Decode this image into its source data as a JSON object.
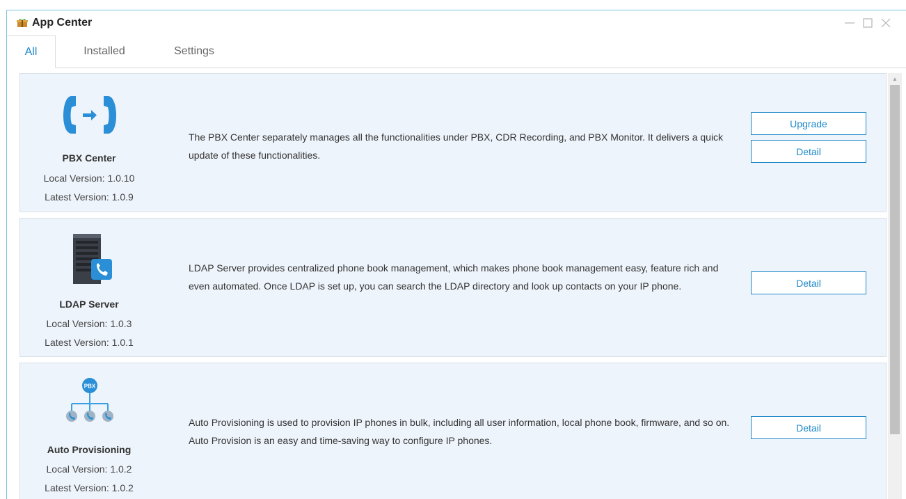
{
  "window": {
    "title": "App Center",
    "icon": "app-center-icon",
    "controls": [
      "minimize-icon",
      "maximize-icon",
      "close-icon"
    ]
  },
  "tabs": [
    {
      "label": "All",
      "active": true
    },
    {
      "label": "Installed",
      "active": false
    },
    {
      "label": "Settings",
      "active": false
    }
  ],
  "apps": [
    {
      "name": "PBX Center",
      "icon": "pbx-center-icon",
      "local_version": "Local Version: 1.0.10",
      "latest_version": "Latest Version: 1.0.9",
      "description": "The PBX Center separately manages all the functionalities under PBX, CDR Recording, and PBX Monitor. It delivers a quick update of these functionalities.",
      "buttons": [
        "Upgrade",
        "Detail"
      ]
    },
    {
      "name": "LDAP Server",
      "icon": "ldap-server-icon",
      "local_version": "Local Version: 1.0.3",
      "latest_version": "Latest Version: 1.0.1",
      "description": "LDAP Server provides centralized phone book management, which makes phone book management easy, feature rich and even automated. Once LDAP is set up, you can search the LDAP directory and look up contacts on your IP phone.",
      "buttons": [
        "Detail"
      ]
    },
    {
      "name": "Auto Provisioning",
      "icon": "auto-provisioning-icon",
      "icon_badge": "PBX",
      "local_version": "Local Version: 1.0.2",
      "latest_version": "Latest Version: 1.0.2",
      "description": "Auto Provisioning is used to provision IP phones in bulk, including all user information, local phone book, firmware, and so on. Auto Provision is an easy and time-saving way to configure IP phones.",
      "buttons": [
        "Detail"
      ]
    }
  ],
  "colors": {
    "accent": "#1e88c8",
    "card_background": "#eef4fb",
    "window_border": "#7fc4dc"
  }
}
